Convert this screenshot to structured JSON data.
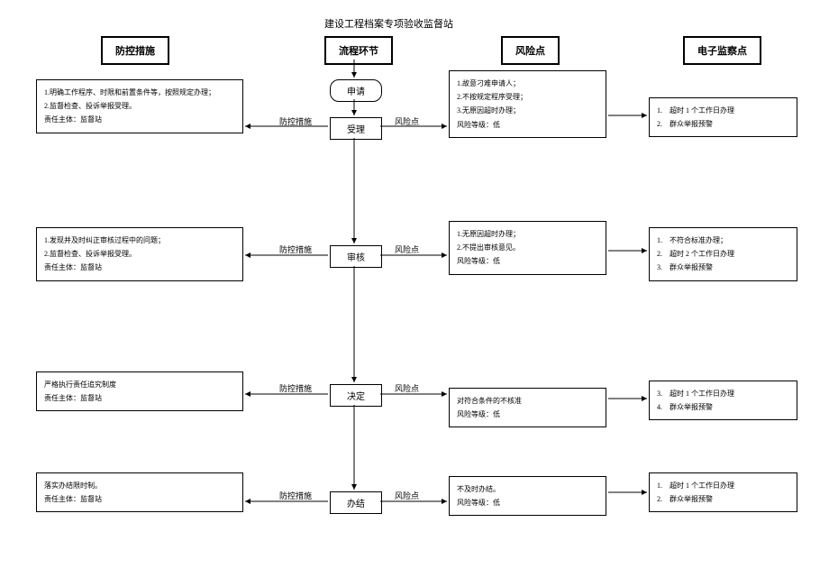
{
  "title": "建设工程档案专项验收监督站",
  "headers": {
    "col1": "防控措施",
    "col2": "流程环节",
    "col3": "风险点",
    "col4": "电子监察点"
  },
  "nodes": {
    "apply": "申请",
    "accept": "受理",
    "review": "审核",
    "decide": "决定",
    "complete": "办结"
  },
  "labels": {
    "control": "防控措施",
    "risk": "风险点"
  },
  "left": {
    "r1": {
      "l1": "1.明确工作程序、时限和前置条件等，按照规定办理；",
      "l2": "2.监督检查、投诉举报受理。",
      "l3": "责任主体：监督站"
    },
    "r2": {
      "l1": "1.发现并及时纠正审核过程中的问题；",
      "l2": "2.监督检查、投诉举报受理。",
      "l3": "责任主体：监督站"
    },
    "r3": {
      "l1": "严格执行责任追究制度",
      "l2": "责任主体：监督站"
    },
    "r4": {
      "l1": "落实办结限时制。",
      "l2": "责任主体：监督站"
    }
  },
  "risk": {
    "r1": {
      "l1": "1.故意刁难申请人；",
      "l2": "2.不按规定程序受理；",
      "l3": "3.无原因超时办理；",
      "l4": "风险等级：低"
    },
    "r2": {
      "l1": "1.无原因超时办理；",
      "l2": "2.不提出审核意见。",
      "l3": "风险等级：低"
    },
    "r3": {
      "l1": "对符合条件的不核准",
      "l2": "风险等级：低"
    },
    "r4": {
      "l1": "不及时办结。",
      "l2": "风险等级：低"
    }
  },
  "monitor": {
    "r1": {
      "l1": "1.　超时 1 个工作日办理",
      "l2": "2.　群众举报预警"
    },
    "r2": {
      "l1": "1.　不符合标准办理；",
      "l2": "2.　超时 2 个工作日办理",
      "l3": "3.　群众举报预警"
    },
    "r3": {
      "l1": "3.　超时 1 个工作日办理",
      "l2": "4.　群众举报预警"
    },
    "r4": {
      "l1": "1.　超时 1 个工作日办理",
      "l2": "2.　群众举报预警"
    }
  }
}
